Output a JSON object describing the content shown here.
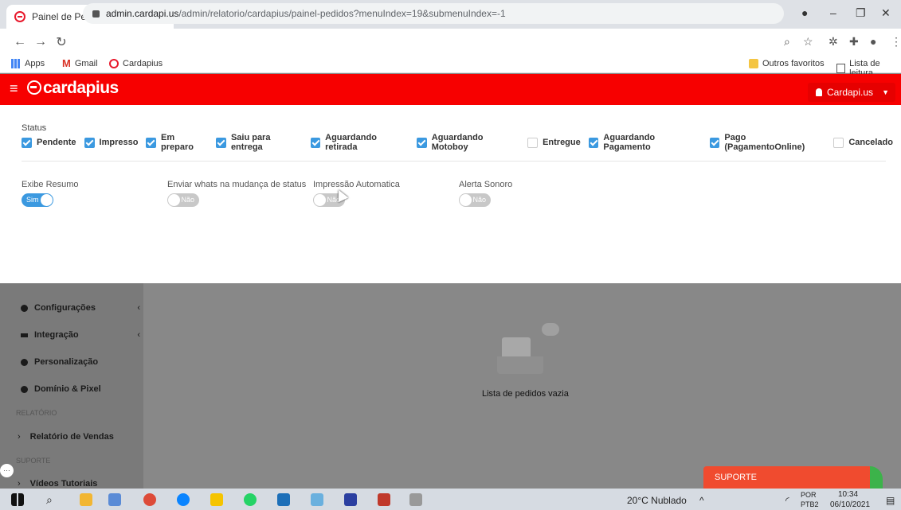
{
  "browser": {
    "tab_title": "Painel de Pedidos",
    "tab_close": "×",
    "new_tab": "+",
    "url_host": "admin.cardapi.us",
    "url_path": "/admin/relatorio/cardapius/painel-pedidos?menuIndex=19&submenuIndex=-1",
    "bookmarks": [
      "Apps",
      "Gmail",
      "Cardapius"
    ],
    "bookmarks_right": [
      "Outros favoritos",
      "Lista de leitura"
    ]
  },
  "header": {
    "logo": "cardapius",
    "user": "Cardapi.us"
  },
  "filters": {
    "status_label": "Status",
    "statuses": [
      {
        "label": "Pendente",
        "checked": true
      },
      {
        "label": "Impresso",
        "checked": true
      },
      {
        "label": "Em preparo",
        "checked": true
      },
      {
        "label": "Saiu para entrega",
        "checked": true
      },
      {
        "label": "Aguardando retirada",
        "checked": true
      },
      {
        "label": "Aguardando Motoboy",
        "checked": true
      },
      {
        "label": "Entregue",
        "checked": false
      },
      {
        "label": "Aguardando Pagamento",
        "checked": true
      },
      {
        "label": "Pago (PagamentoOnline)",
        "checked": true
      },
      {
        "label": "Cancelado",
        "checked": false
      }
    ]
  },
  "toggles": {
    "exibe_resumo": {
      "label": "Exibe Resumo",
      "value": "Sim"
    },
    "enviar_whats": {
      "label": "Enviar whats na mudança de status",
      "value": "Não"
    },
    "impressao": {
      "label": "Impressão Automatica",
      "value": "Não"
    },
    "alerta": {
      "label": "Alerta Sonoro",
      "value": "Não"
    }
  },
  "sidebar": {
    "items": [
      "Configurações",
      "Integração",
      "Personalização",
      "Domínio & Pixel"
    ],
    "section_relatorio": "RELATÓRIO",
    "relatorio_item": "Relatório de Vendas",
    "section_suporte": "SUPORTE",
    "suporte_item": "Vídeos Tutoriais"
  },
  "main": {
    "empty_text": "Lista de pedidos vazia",
    "suporte_button": "SUPORTE"
  },
  "taskbar": {
    "weather": "20°C  Nublado",
    "lang_1": "POR",
    "lang_2": "PTB2",
    "time": "10:34",
    "date": "06/10/2021"
  },
  "colors": {
    "brand_red": "#f70000",
    "checkbox_blue": "#3b99e0",
    "suporte_orange": "#f04b2f"
  }
}
